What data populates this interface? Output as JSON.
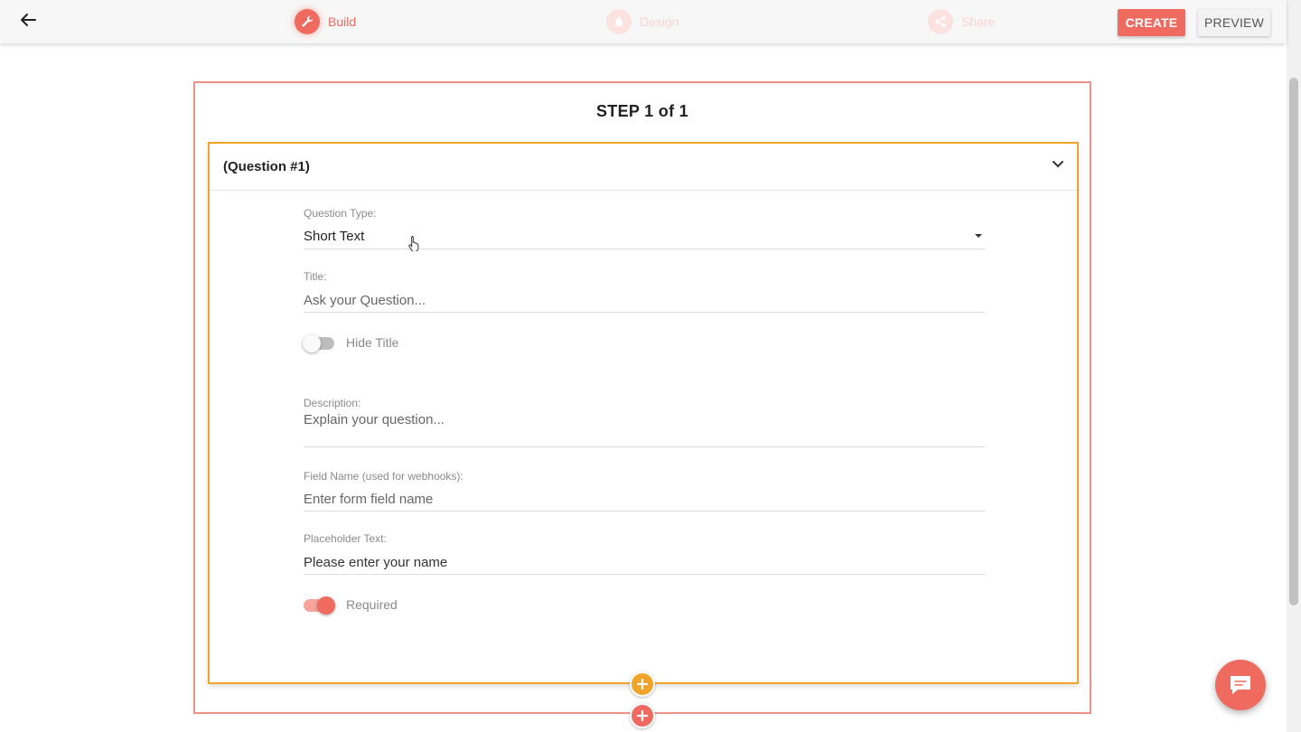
{
  "header": {
    "steps": [
      {
        "label": "Build",
        "icon": "wrench-icon",
        "active": true
      },
      {
        "label": "Design",
        "icon": "droplet-icon",
        "active": false
      },
      {
        "label": "Share",
        "icon": "share-icon",
        "active": false
      }
    ],
    "create_label": "CREATE",
    "preview_label": "PREVIEW"
  },
  "step": {
    "title": "STEP 1 of 1"
  },
  "question": {
    "title": "(Question #1)",
    "type_label": "Question Type:",
    "type_value": "Short Text",
    "title_label": "Title:",
    "title_placeholder": "Ask your Question...",
    "hide_title_label": "Hide Title",
    "hide_title_on": false,
    "description_label": "Description:",
    "description_placeholder": "Explain your question...",
    "field_name_label": "Field Name (used for webhooks):",
    "field_name_placeholder": "Enter form field name",
    "placeholder_label": "Placeholder Text:",
    "placeholder_value": "Please enter your name",
    "required_label": "Required",
    "required_on": true
  },
  "colors": {
    "accent": "#f06b5f",
    "question_border": "#f1a32a",
    "step_border": "#f0908a"
  }
}
